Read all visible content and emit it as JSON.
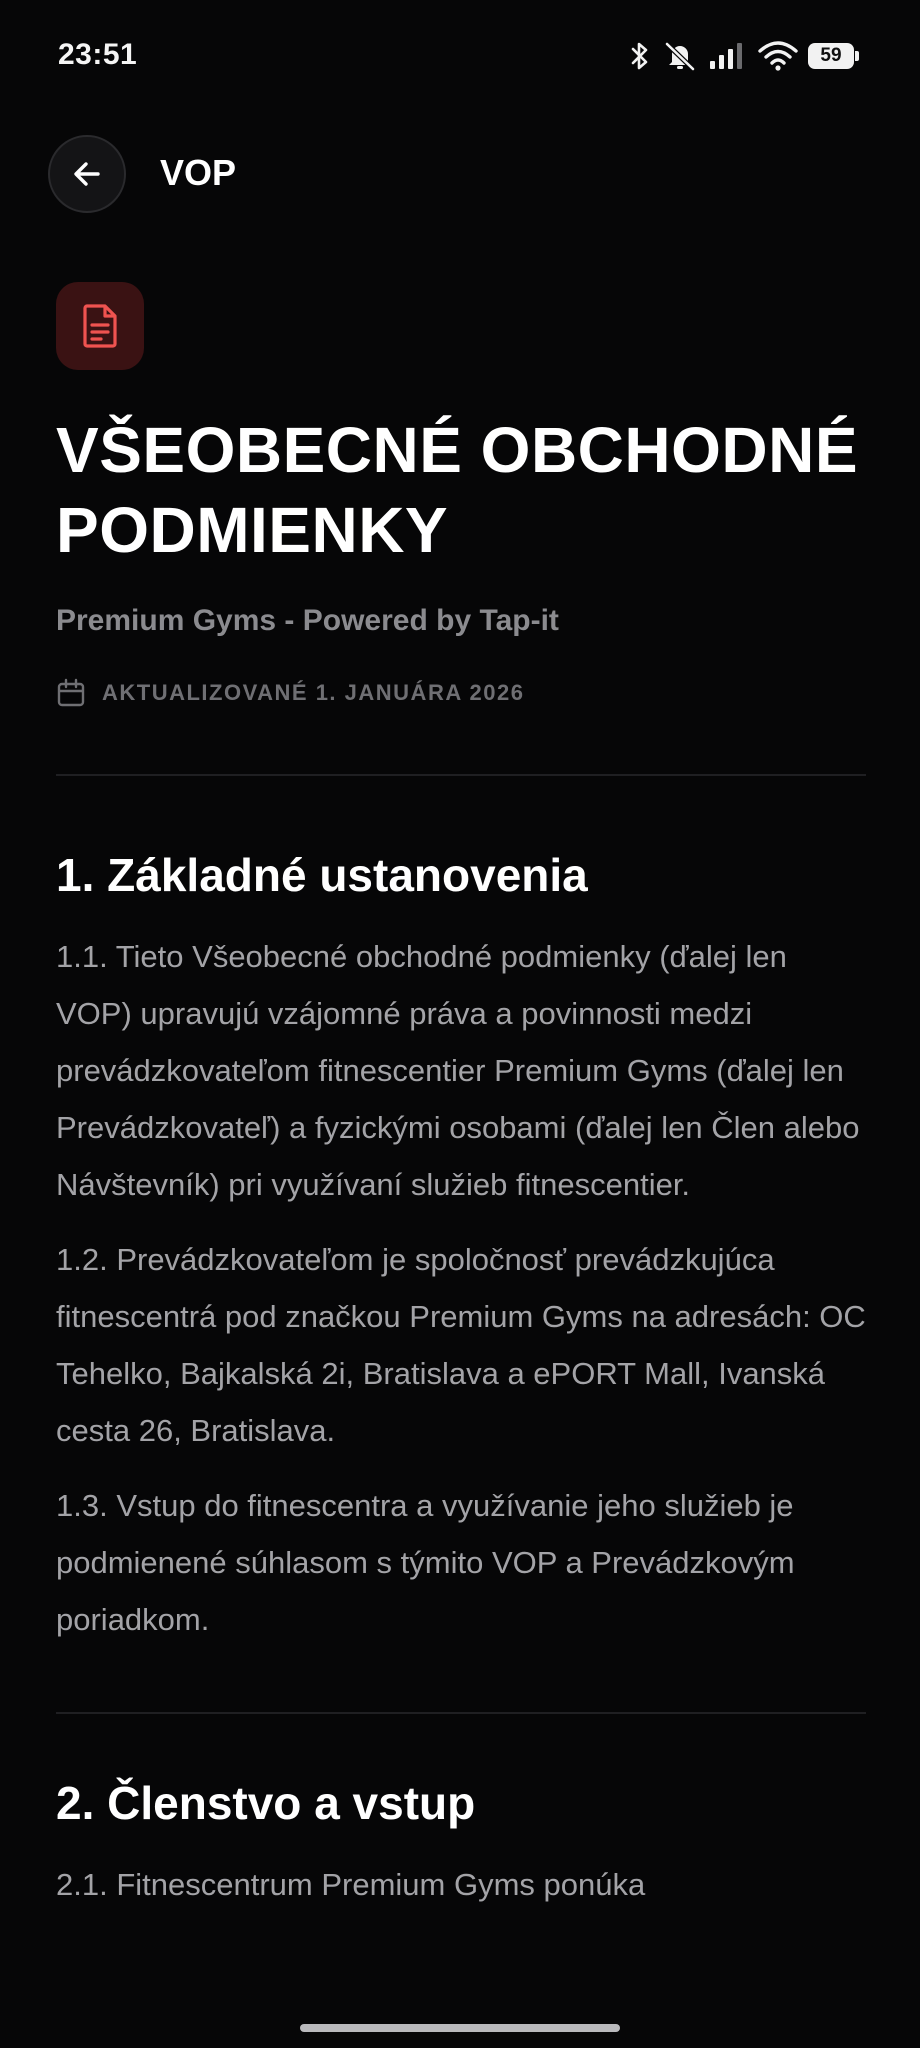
{
  "status_bar": {
    "time": "23:51",
    "battery": "59",
    "icons": [
      "bluetooth-icon",
      "mute-icon",
      "signal-icon",
      "wifi-icon",
      "battery-icon"
    ]
  },
  "header": {
    "title": "VOP",
    "back_icon": "arrow-left-icon"
  },
  "document": {
    "badge_icon": "document-icon",
    "accent_color": "#ef5350",
    "title": "VŠEOBECNÉ OBCHODNÉ PODMIENKY",
    "subtitle": "Premium Gyms - Powered by Tap-it",
    "updated_icon": "calendar-icon",
    "updated": "AKTUALIZOVANÉ 1. JANUÁRA 2026"
  },
  "sections": [
    {
      "heading": "1. Základné ustanovenia",
      "paragraphs": [
        "1.1. Tieto Všeobecné obchodné podmienky (ďalej len VOP) upravujú vzájomné práva a povinnosti medzi prevádzkovateľom fitnescentier Premium Gyms (ďalej len Prevádzkovateľ) a fyzickými osobami (ďalej len Člen alebo Návštevník) pri využívaní služieb fitnescentier.",
        "1.2. Prevádzkovateľom je spoločnosť prevádzkujúca fitnescentrá pod značkou Premium Gyms na adresách: OC Tehelko, Bajkalská 2i, Bratislava a ePORT Mall, Ivanská cesta 26, Bratislava.",
        "1.3. Vstup do fitnescentra a využívanie jeho služieb je podmienené súhlasom s týmito VOP a Prevádzkovým poriadkom."
      ]
    },
    {
      "heading": "2. Členstvo a vstup",
      "paragraphs": [
        "2.1. Fitnescentrum Premium Gyms ponúka"
      ]
    }
  ]
}
